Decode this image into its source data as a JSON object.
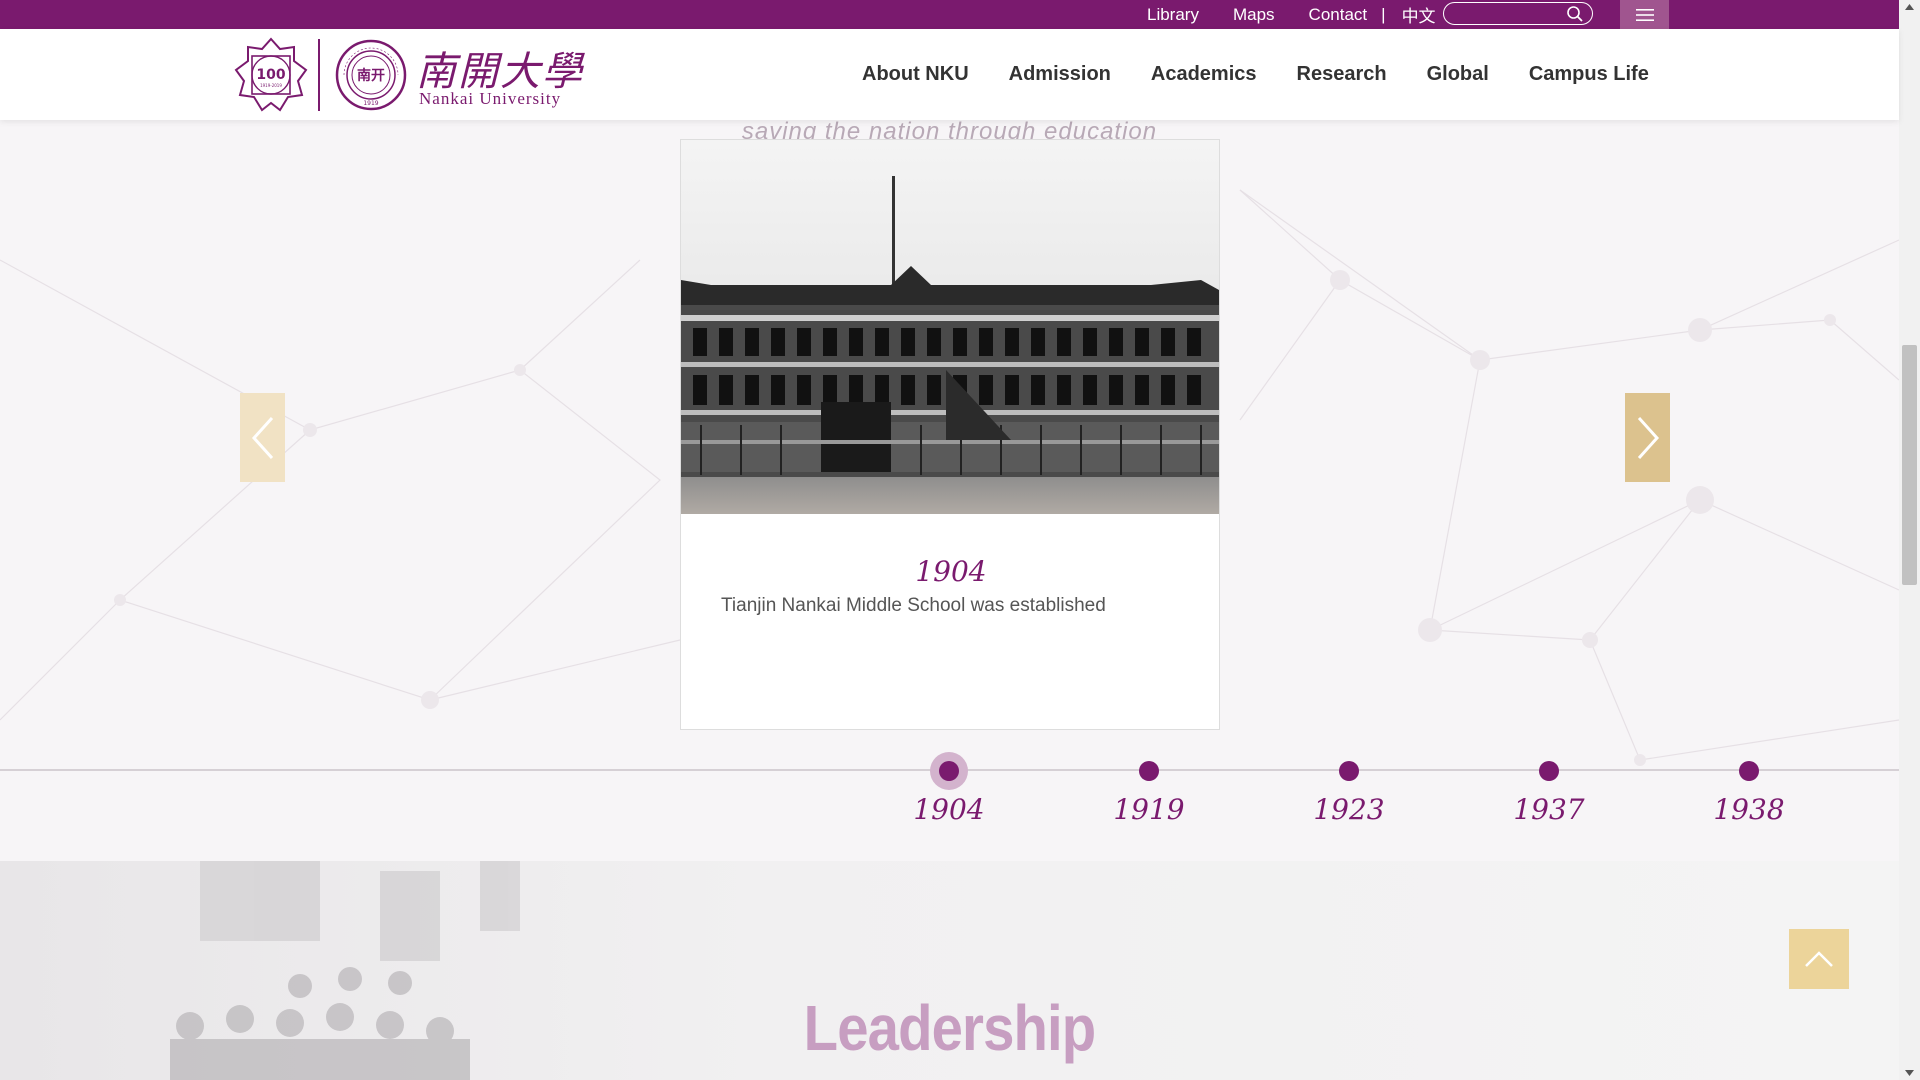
{
  "topbar": {
    "links": [
      "Library",
      "Maps",
      "Contact"
    ],
    "separator": "|",
    "language": "中文",
    "search_placeholder": ""
  },
  "header": {
    "logo_badge_text": "100",
    "logo_badge_years": "1919-2019",
    "logo_seal_text": "南开",
    "logo_seal_year": "1919",
    "logo_cn": "南開大學",
    "logo_en": "Nankai University",
    "nav": [
      "About NKU",
      "Admission",
      "Academics",
      "Research",
      "Global",
      "Campus Life"
    ]
  },
  "history": {
    "motto": "saving the nation through education",
    "card": {
      "year": "1904",
      "description": "Tianjin Nankai Middle School was established"
    },
    "timeline": [
      "1904",
      "1919",
      "1923",
      "1937",
      "1938"
    ],
    "active_year": "1904"
  },
  "leadership": {
    "title": "Leadership"
  },
  "colors": {
    "brand_purple": "#7a1a6e",
    "gold": "#dcc28e",
    "light_gold": "#f1e2c4"
  }
}
